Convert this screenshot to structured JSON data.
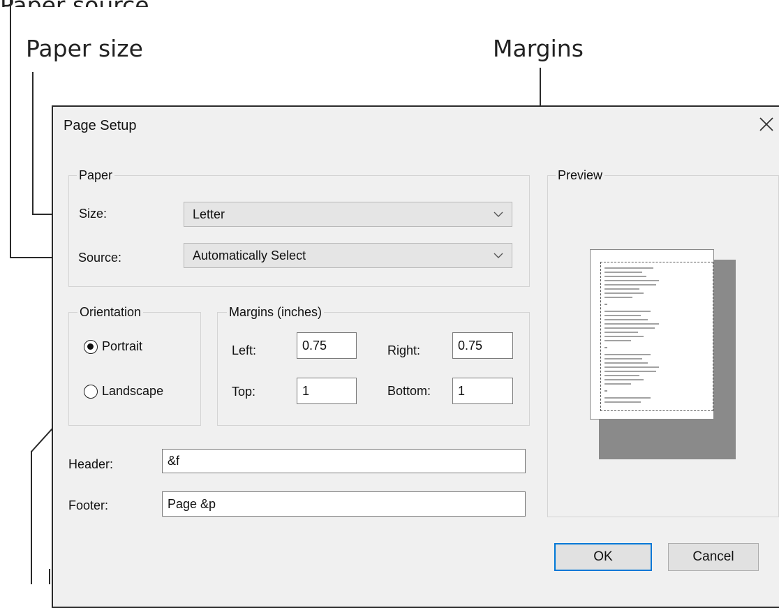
{
  "callouts": {
    "top_cut_label": "Paper source",
    "paper_size": "Paper size",
    "margins": "Margins"
  },
  "dialog": {
    "title": "Page Setup",
    "close_icon": "close-icon",
    "paper": {
      "group_label": "Paper",
      "size_label": "Size:",
      "size_value": "Letter",
      "source_label": "Source:",
      "source_value": "Automatically Select"
    },
    "orientation": {
      "group_label": "Orientation",
      "portrait_label": "Portrait",
      "landscape_label": "Landscape",
      "selected": "Portrait"
    },
    "margins": {
      "group_label": "Margins (inches)",
      "left_label": "Left:",
      "left_value": "0.75",
      "right_label": "Right:",
      "right_value": "0.75",
      "top_label": "Top:",
      "top_value": "1",
      "bottom_label": "Bottom:",
      "bottom_value": "1"
    },
    "header_label": "Header:",
    "header_value": "&f",
    "footer_label": "Footer:",
    "footer_value": "Page &p",
    "preview": {
      "group_label": "Preview"
    },
    "buttons": {
      "ok": "OK",
      "cancel": "Cancel"
    }
  },
  "colors": {
    "dialog_bg": "#f0f0f0",
    "default_button_border": "#0078d7",
    "combo_bg": "#e5e5e5"
  }
}
